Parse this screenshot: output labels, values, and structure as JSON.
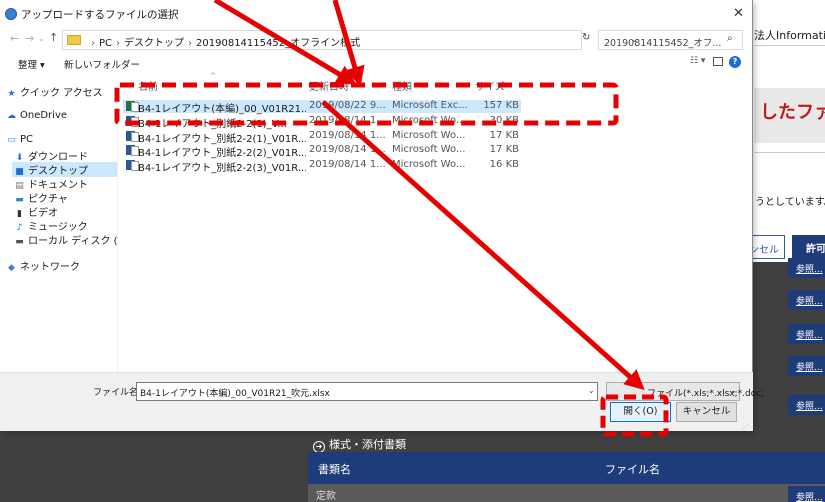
{
  "background": {
    "info_text": "法人Information",
    "banner_text": "したファイ",
    "message": "うとしています。",
    "cancel_label": "ンセル",
    "allow_label": "許可",
    "ref_label": "参照...",
    "section_title": "様式・添付書類",
    "table_headers": [
      "書類名",
      "ファイル名"
    ],
    "row_label": "定款"
  },
  "dialog": {
    "title": "アップロードするファイルの選択",
    "close_glyph": "✕",
    "path": [
      "PC",
      "デスクトップ",
      "20190814115452_オフライン様式"
    ],
    "search_placeholder": "20190814115452_オフ...",
    "organize": "整理 ▾",
    "new_folder": "新しいフォルダー",
    "nav_items": [
      {
        "label": "クイック アクセス",
        "icon": "star-icon"
      },
      {
        "label": "OneDrive",
        "icon": "cloud-icon"
      },
      {
        "label": "PC",
        "icon": "computer-icon"
      },
      {
        "label": "ダウンロード",
        "icon": "download-icon"
      },
      {
        "label": "デスクトップ",
        "icon": "desktop-icon"
      },
      {
        "label": "ドキュメント",
        "icon": "document-icon"
      },
      {
        "label": "ピクチャ",
        "icon": "picture-icon"
      },
      {
        "label": "ビデオ",
        "icon": "video-icon"
      },
      {
        "label": "ミュージック",
        "icon": "music-icon"
      },
      {
        "label": "ローカル ディスク (",
        "icon": "disk-icon"
      },
      {
        "label": "ネットワーク",
        "icon": "network-icon"
      }
    ],
    "columns": [
      "名前",
      "更新日時",
      "種類",
      "サイズ"
    ],
    "files": [
      {
        "name": "B4-1レイアウト(本編)_00_V01R21...",
        "date": "2019/08/22 9...",
        "type": "Microsoft Exc...",
        "size": "157 KB",
        "kind": "excel"
      },
      {
        "name": "B4-1レイアウト_別紙2-2(1)_V...",
        "date": "2019/08/14 1...",
        "type": "Microsoft Wo...",
        "size": "30 KB",
        "kind": "word"
      },
      {
        "name": "B4-1レイアウト_別紙2-2(1)_V01R...",
        "date": "2019/08/14 1...",
        "type": "Microsoft Wo...",
        "size": "17 KB",
        "kind": "word"
      },
      {
        "name": "B4-1レイアウト_別紙2-2(2)_V01R...",
        "date": "2019/08/14 1...",
        "type": "Microsoft Wo...",
        "size": "17 KB",
        "kind": "word"
      },
      {
        "name": "B4-1レイアウト_別紙2-2(3)_V01R...",
        "date": "2019/08/14 1...",
        "type": "Microsoft Wo...",
        "size": "16 KB",
        "kind": "word"
      }
    ],
    "filename_label": "ファイル名(N):",
    "filename_value": "B4-1レイアウト(本編)_00_V01R21_吹元.xlsx",
    "filetype_value": "ファイル(*.xls;*.xlsx;*.doc;",
    "open_label": "開く(O)",
    "cancel_label": "キャンセル"
  },
  "colors": {
    "annotation_red": "#e60000",
    "selection_blue": "#cce8ff",
    "page_navy": "#1e3c7a"
  }
}
